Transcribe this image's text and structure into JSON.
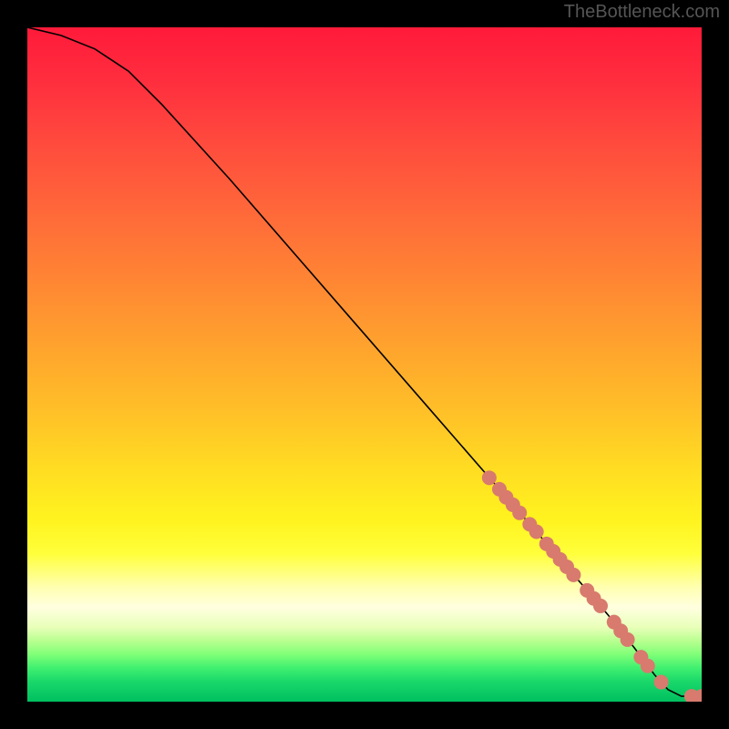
{
  "attribution": "TheBottleneck.com",
  "chart_data": {
    "type": "line",
    "title": "",
    "xlabel": "",
    "ylabel": "",
    "xlim": [
      0,
      100
    ],
    "ylim": [
      0,
      100
    ],
    "curve": [
      {
        "x": 0,
        "y": 100
      },
      {
        "x": 5,
        "y": 98.8
      },
      {
        "x": 10,
        "y": 96.8
      },
      {
        "x": 15,
        "y": 93.5
      },
      {
        "x": 20,
        "y": 88.5
      },
      {
        "x": 30,
        "y": 77.5
      },
      {
        "x": 40,
        "y": 66.0
      },
      {
        "x": 50,
        "y": 54.5
      },
      {
        "x": 60,
        "y": 43.0
      },
      {
        "x": 70,
        "y": 31.5
      },
      {
        "x": 80,
        "y": 20.0
      },
      {
        "x": 86,
        "y": 13.0
      },
      {
        "x": 90,
        "y": 8.0
      },
      {
        "x": 93,
        "y": 4.0
      },
      {
        "x": 95,
        "y": 1.8
      },
      {
        "x": 97,
        "y": 0.8
      },
      {
        "x": 100,
        "y": 0.8
      }
    ],
    "markers": [
      {
        "x": 68.5,
        "y": 33.2
      },
      {
        "x": 70.0,
        "y": 31.5
      },
      {
        "x": 71.0,
        "y": 30.3
      },
      {
        "x": 72.0,
        "y": 29.2
      },
      {
        "x": 73.0,
        "y": 28.0
      },
      {
        "x": 74.5,
        "y": 26.3
      },
      {
        "x": 75.5,
        "y": 25.2
      },
      {
        "x": 77.0,
        "y": 23.4
      },
      {
        "x": 78.0,
        "y": 22.3
      },
      {
        "x": 79.0,
        "y": 21.1
      },
      {
        "x": 80.0,
        "y": 20.0
      },
      {
        "x": 81.0,
        "y": 18.8
      },
      {
        "x": 83.0,
        "y": 16.5
      },
      {
        "x": 84.0,
        "y": 15.3
      },
      {
        "x": 85.0,
        "y": 14.2
      },
      {
        "x": 87.0,
        "y": 11.8
      },
      {
        "x": 88.0,
        "y": 10.5
      },
      {
        "x": 89.0,
        "y": 9.2
      },
      {
        "x": 91.0,
        "y": 6.6
      },
      {
        "x": 92.0,
        "y": 5.3
      },
      {
        "x": 94.0,
        "y": 2.9
      },
      {
        "x": 98.5,
        "y": 0.8
      },
      {
        "x": 100.0,
        "y": 0.8
      }
    ],
    "marker_color": "#d87a6e",
    "curve_color": "#000000"
  }
}
